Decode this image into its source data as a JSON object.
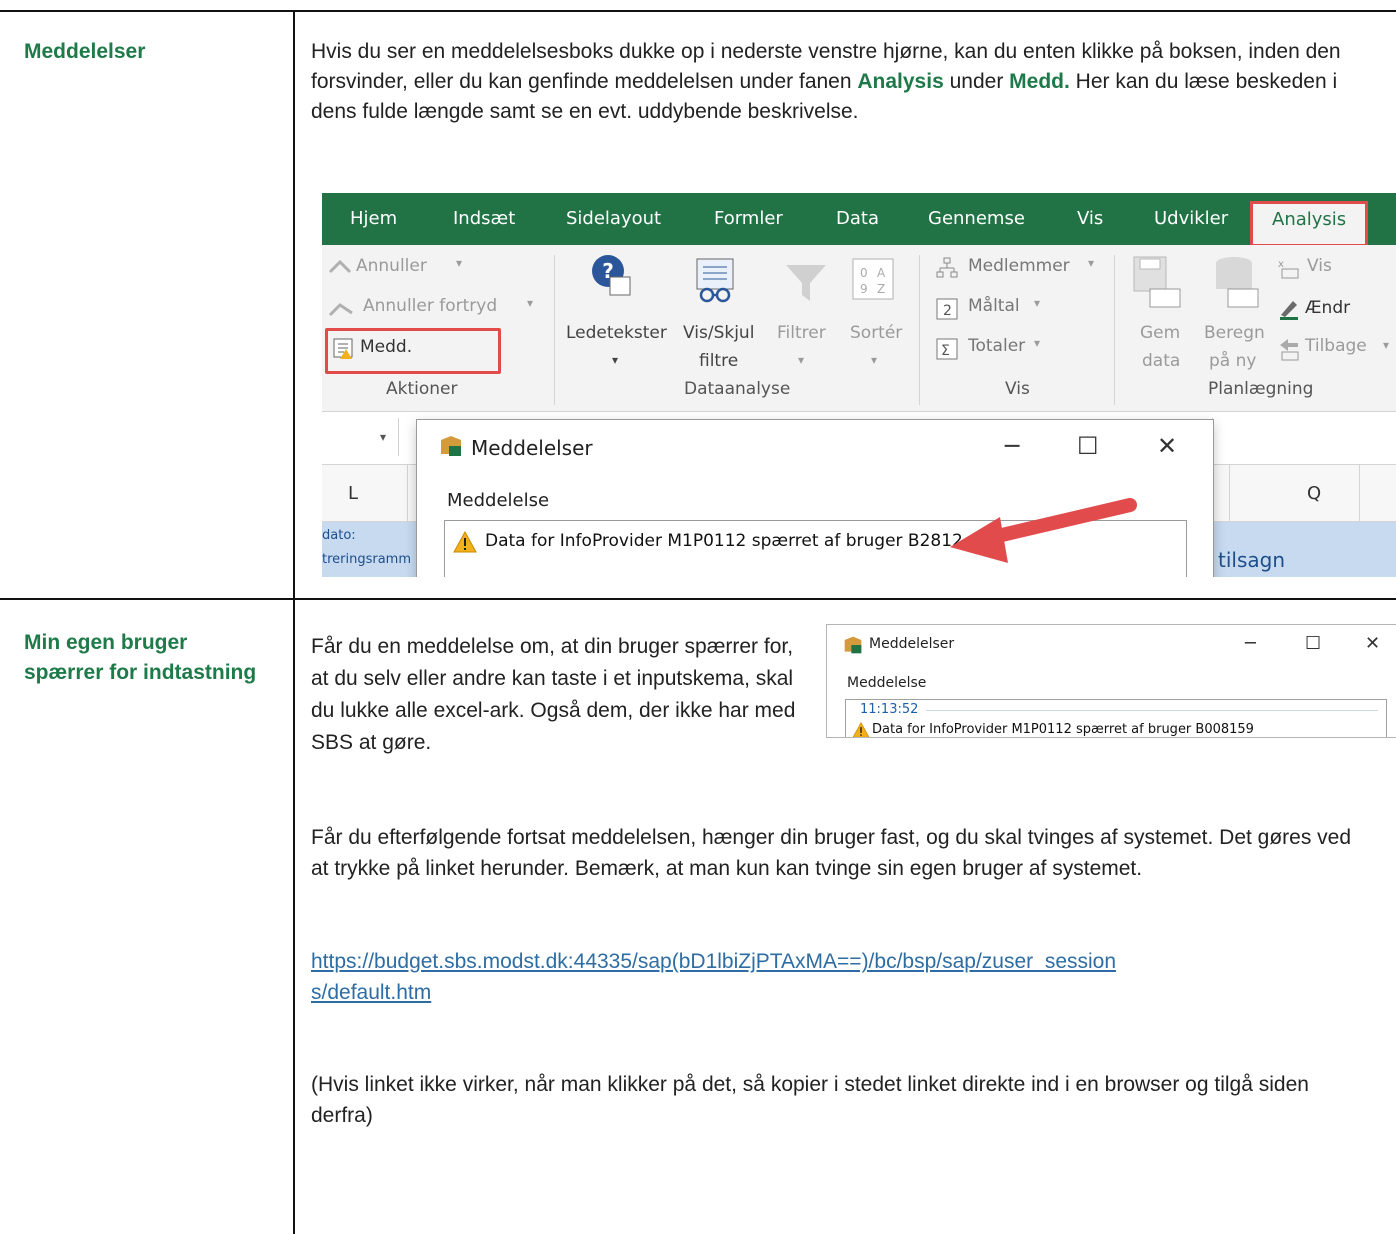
{
  "rows": [
    {
      "heading": "Meddelelser",
      "intro_pre": "Hvis du ser en meddelelsesboks dukke op i nederste venstre hjørne, kan du enten klikke på boksen, inden den forsvinder, eller du kan genfinde meddelelsen under fanen ",
      "intro_tab": "Analysis",
      "intro_mid": " under ",
      "intro_btn": "Medd.",
      "intro_post": " Her kan du læse beskeden i dens fulde længde samt se en evt. uddybende beskrivelse."
    },
    {
      "heading": "Min egen bruger spærrer for indtastning",
      "para1": "Får du en meddelelse om, at din bruger spærrer for, at du selv eller andre kan taste i et inputskema, skal du lukke alle excel-ark. Også dem, der ikke har med SBS at gøre.",
      "para2": "Får du efterfølgende fortsat meddelelsen, hænger din bruger fast, og du skal tvinges af systemet. Det gøres ved at trykke på linket herunder. Bemærk, at man kun kan tvinge sin egen bruger af systemet.",
      "link_line1": "https://budget.sbs.modst.dk:44335/sap(bD1lbiZjPTAxMA==)/bc/bsp/sap/zuser_session",
      "link_line2": "s/default.htm",
      "para3": "(Hvis linket ikke virker, når man klikker på det, så kopier i stedet linket direkte ind i en browser og tilgå siden derfra)"
    }
  ],
  "excel": {
    "tabs": [
      "Hjem",
      "Indsæt",
      "Sidelayout",
      "Formler",
      "Data",
      "Gennemse",
      "Vis",
      "Udvikler",
      "Analysis"
    ],
    "actions": {
      "undo": "Annuller",
      "redo": "Annuller fortryd",
      "medd": "Medd.",
      "group": "Aktioner"
    },
    "dataanalyse": {
      "prompts": "Ledetekster",
      "vis_skjul_1": "Vis/Skjul",
      "vis_skjul_2": "filtre",
      "filter": "Filtrer",
      "sort": "Sortér",
      "group": "Dataanalyse"
    },
    "vis": {
      "members": "Medlemmer",
      "measures": "Måltal",
      "totals": "Totaler",
      "group": "Vis"
    },
    "planning": {
      "save_1": "Gem",
      "save_2": "data",
      "recalc_1": "Beregn",
      "recalc_2": "på ny",
      "show": "Vis",
      "change": "Ændr",
      "back": "Tilbage",
      "group": "Planlægning"
    },
    "columns": {
      "l": "L",
      "q": "Q"
    },
    "cells": {
      "dato": "dato:",
      "ramme": "treringsramm",
      "tilsagn": "tilsagn"
    },
    "dialog": {
      "title": "Meddelelser",
      "label": "Meddelelse",
      "message": "Data for InfoProvider M1P0112 spærret af bruger B2812"
    }
  },
  "dialog2": {
    "title": "Meddelelser",
    "label": "Meddelelse",
    "time": "11:13:52",
    "message": "Data for InfoProvider M1P0112 spærret af bruger B008159"
  },
  "colors": {
    "accent": "#1f7a4a",
    "excel_green": "#217346",
    "highlight": "#e24b4b",
    "link": "#2e6da4"
  }
}
